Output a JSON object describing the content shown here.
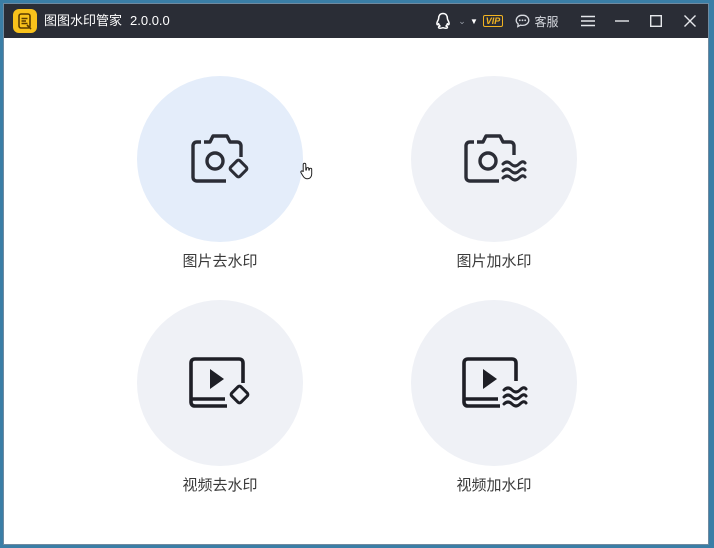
{
  "window": {
    "title": "图图水印管家",
    "version": "2.0.0.0"
  },
  "titlebar": {
    "vip_label": "VIP",
    "service_label": "客服"
  },
  "features": [
    {
      "label": "图片去水印",
      "icon": "camera-eraser-icon"
    },
    {
      "label": "图片加水印",
      "icon": "camera-wave-icon"
    },
    {
      "label": "视频去水印",
      "icon": "video-eraser-icon"
    },
    {
      "label": "视频加水印",
      "icon": "video-wave-icon"
    }
  ],
  "colors": {
    "titlebar_bg": "#2a2d36",
    "logo": "#f9c21b",
    "vip": "#f1b321",
    "circle_bg": "#eff1f6",
    "circle_hover_bg": "#e4edfa"
  }
}
